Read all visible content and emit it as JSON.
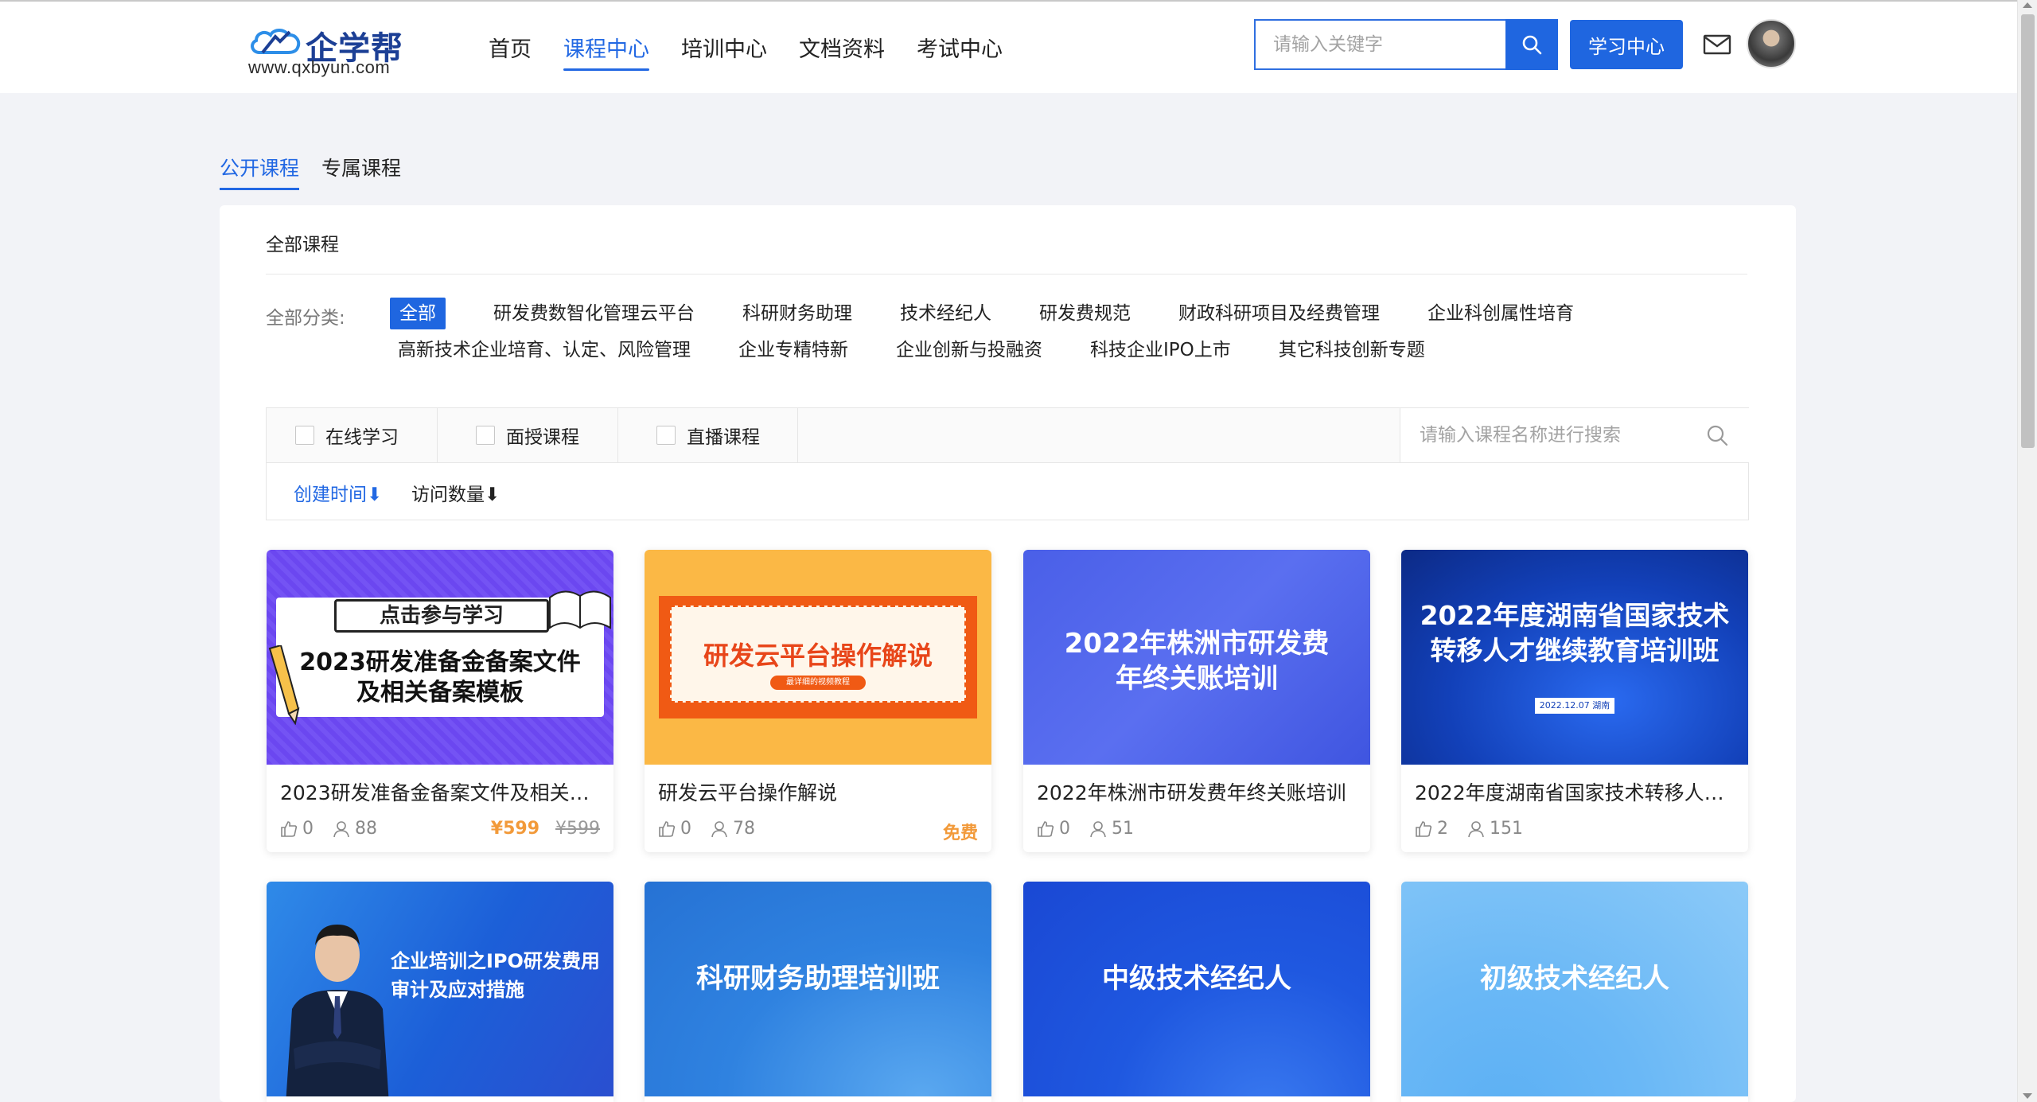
{
  "header": {
    "logo_name": "企学帮",
    "logo_url": "www.qxbyun.com",
    "nav": [
      {
        "label": "首页",
        "active": false
      },
      {
        "label": "课程中心",
        "active": true
      },
      {
        "label": "培训中心",
        "active": false
      },
      {
        "label": "文档资料",
        "active": false
      },
      {
        "label": "考试中心",
        "active": false
      }
    ],
    "search_placeholder": "请输入关键字",
    "study_center_label": "学习中心"
  },
  "page_tabs": [
    {
      "label": "公开课程",
      "active": true
    },
    {
      "label": "专属课程",
      "active": false
    }
  ],
  "panel": {
    "title": "全部课程",
    "category_label": "全部分类:",
    "categories_row1": [
      "全部",
      "研发费数智化管理云平台",
      "科研财务助理",
      "技术经纪人",
      "研发费规范",
      "财政科研项目及经费管理",
      "企业科创属性培育"
    ],
    "categories_row2": [
      "高新技术企业培育、认定、风险管理",
      "企业专精特新",
      "企业创新与投融资",
      "科技企业IPO上市",
      "其它科技创新专题"
    ],
    "filters": [
      "在线学习",
      "面授课程",
      "直播课程"
    ],
    "course_search_placeholder": "请输入课程名称进行搜索",
    "sort": [
      {
        "label": "创建时间",
        "arrow": "⬇",
        "active": true
      },
      {
        "label": "访问数量",
        "arrow": "⬇",
        "active": false
      }
    ]
  },
  "courses": [
    {
      "title": "2023研发准备金备案文件及相关备案模板",
      "likes": "0",
      "views": "88",
      "price": "¥599",
      "old_price": "¥599",
      "banner_tag": "点击参与学习",
      "banner_line1": "2023研发准备金备案文件",
      "banner_line2": "及相关备案模板"
    },
    {
      "title": "研发云平台操作解说",
      "likes": "0",
      "views": "78",
      "price_free": "免费",
      "banner_line1": "研发云平台操作解说",
      "banner_sub": "最详细的视频教程"
    },
    {
      "title": "2022年株洲市研发费年终关账培训",
      "likes": "0",
      "views": "51",
      "banner_line1": "2022年株洲市研发费",
      "banner_line2": "年终关账培训"
    },
    {
      "title": "2022年度湖南省国家技术转移人才继续教育培训班",
      "likes": "2",
      "views": "151",
      "banner_line1": "2022年度湖南省国家技术",
      "banner_line2": "转移人才继续教育培训班",
      "banner_date": "2022.12.07  湖南"
    },
    {
      "banner_line1": "企业培训之IPO研发费用",
      "banner_line2": "审计及应对措施"
    },
    {
      "banner_line1": "科研财务助理培训班"
    },
    {
      "banner_line1": "中级技术经纪人"
    },
    {
      "banner_line1": "初级技术经纪人"
    }
  ],
  "colors": {
    "accent": "#1f66e0",
    "price": "#f29a3a"
  }
}
